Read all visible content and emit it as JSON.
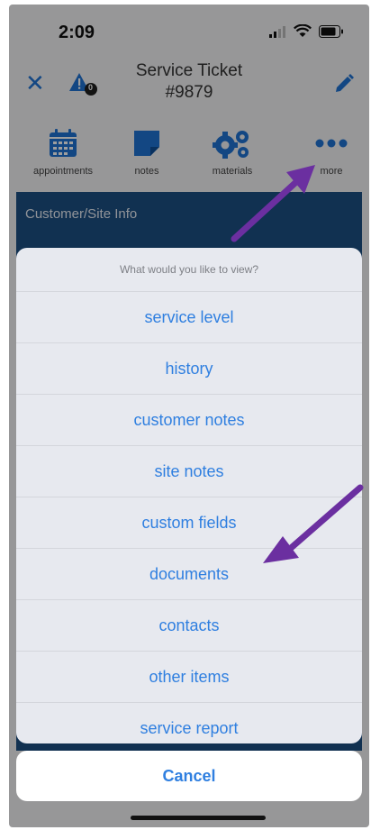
{
  "status": {
    "time": "2:09"
  },
  "nav": {
    "title_line1": "Service Ticket",
    "title_line2": "#9879"
  },
  "toolbar": {
    "items": [
      {
        "label": "appointments"
      },
      {
        "label": "notes"
      },
      {
        "label": "materials"
      },
      {
        "label": "more"
      }
    ]
  },
  "section": {
    "header": "Customer/Site Info"
  },
  "action_sheet": {
    "title": "What would you like to view?",
    "items": [
      {
        "label": "service level"
      },
      {
        "label": "history"
      },
      {
        "label": "customer notes"
      },
      {
        "label": "site notes"
      },
      {
        "label": "custom fields"
      },
      {
        "label": "documents"
      },
      {
        "label": "contacts"
      },
      {
        "label": "other items"
      },
      {
        "label": "service report"
      }
    ],
    "cancel": "Cancel"
  },
  "colors": {
    "accent": "#2f7fe0",
    "header_bg": "#1c4f84",
    "annotation_arrow": "#6b2fa0"
  },
  "alert_badge": {
    "count": "0"
  }
}
